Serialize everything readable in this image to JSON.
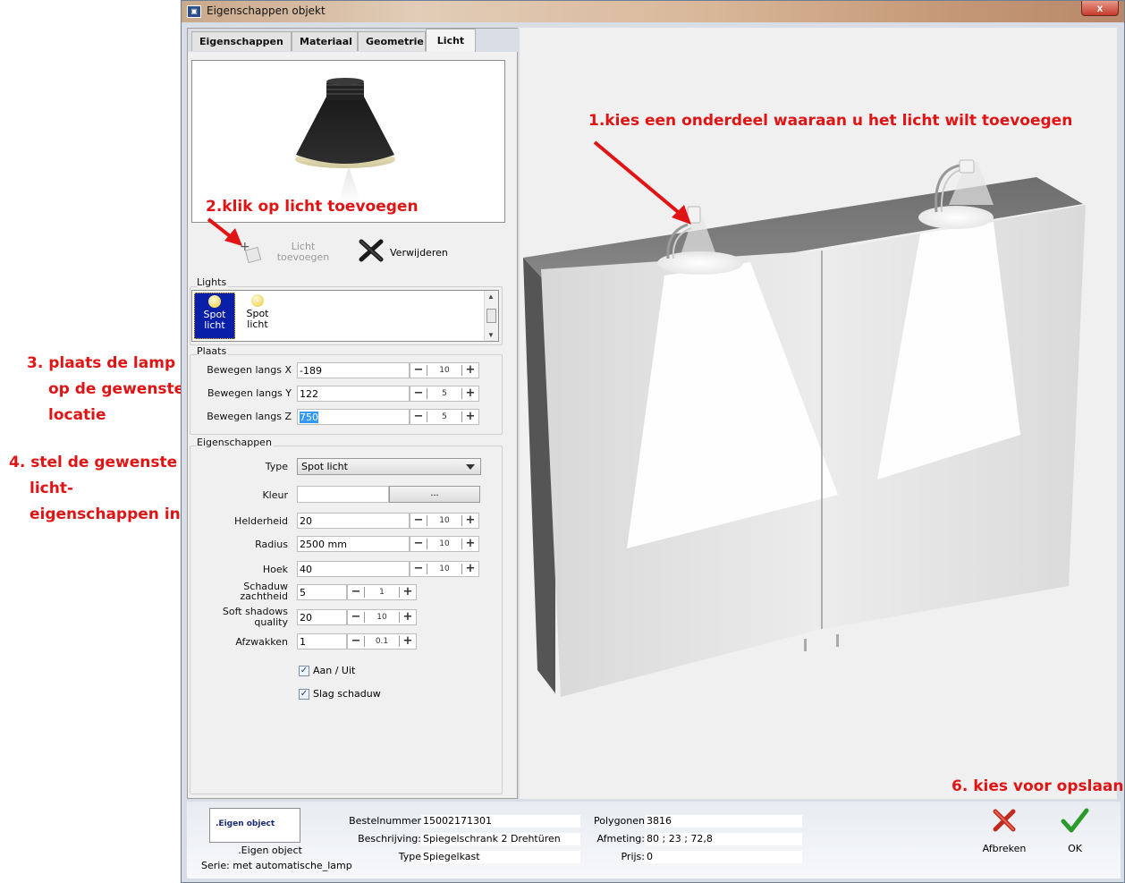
{
  "window": {
    "title": "Eigenschappen objekt",
    "close": "x"
  },
  "tabs": [
    "Eigenschappen",
    "Materiaal",
    "Geometrie",
    "Licht"
  ],
  "active_tab": "Licht",
  "toolbar": {
    "add_light_line1": "Licht",
    "add_light_line2": "toevoegen",
    "remove_label": "Verwijderen"
  },
  "lights": {
    "title": "Lights",
    "items": [
      {
        "line1": "Spot",
        "line2": "licht",
        "selected": true
      },
      {
        "line1": "Spot",
        "line2": "licht",
        "selected": false
      }
    ]
  },
  "plaats": {
    "title": "Plaats",
    "rows": [
      {
        "label": "Bewegen langs X",
        "value": "-189",
        "step": "10"
      },
      {
        "label": "Bewegen langs Y",
        "value": "122",
        "step": "5"
      },
      {
        "label": "Bewegen langs Z",
        "value": "750",
        "step": "5"
      }
    ]
  },
  "eigenschappen": {
    "title": "Eigenschappen",
    "type_label": "Type",
    "type_value": "Spot licht",
    "kleur_label": "Kleur",
    "kleur_button": "...",
    "rows": [
      {
        "label": "Helderheid",
        "value": "20",
        "step": "10"
      },
      {
        "label": "Radius",
        "value": "2500 mm",
        "step": "10"
      },
      {
        "label": "Hoek",
        "value": "40",
        "step": "10"
      }
    ],
    "small_rows": [
      {
        "label1": "Schaduw",
        "label2": "zachtheid",
        "value": "5",
        "step": "1"
      },
      {
        "label1": "Soft shadows",
        "label2": "quality",
        "value": "20",
        "step": "10"
      },
      {
        "label1": "Afzwakken",
        "label2": "",
        "value": "1",
        "step": "0.1"
      }
    ],
    "aan_uit": "Aan / Uit",
    "slag_schaduw": "Slag schaduw"
  },
  "bottom": {
    "box_text": ".Eigen object",
    "name": ".Eigen object",
    "serie": "Serie: met automatische_lamp",
    "bestelnummer_label": "Bestelnummer",
    "bestelnummer": "15002171301",
    "beschrijving_label": "Beschrijving:",
    "beschrijving": "Spiegelschrank 2 Drehtüren",
    "type_label": "Type",
    "type": "Spiegelkast",
    "polygonen_label": "Polygonen",
    "polygonen": "3816",
    "afmeting_label": "Afmeting:",
    "afmeting": "80 ; 23 ; 72,8",
    "prijs_label": "Prijs:",
    "prijs": "0",
    "afbreken": "Afbreken",
    "ok": "OK"
  },
  "annotations": {
    "step1": "1.kies een onderdeel waaraan u het licht wilt toevoegen",
    "step2": "2.klik op licht toevoegen",
    "step3_line1": "3. plaats de lamp",
    "step3_line2": "op de gewenste",
    "step3_line3": "locatie",
    "step4_line1": "4. stel de gewenste",
    "step4_line2": "licht-",
    "step4_line3": "eigenschappen in.",
    "step6": "6. kies voor opslaan"
  },
  "colors": {
    "annotation": "#e01414",
    "selection": "#0a1fa8",
    "accept": "#2a9a2a",
    "cancel": "#c02a20"
  }
}
